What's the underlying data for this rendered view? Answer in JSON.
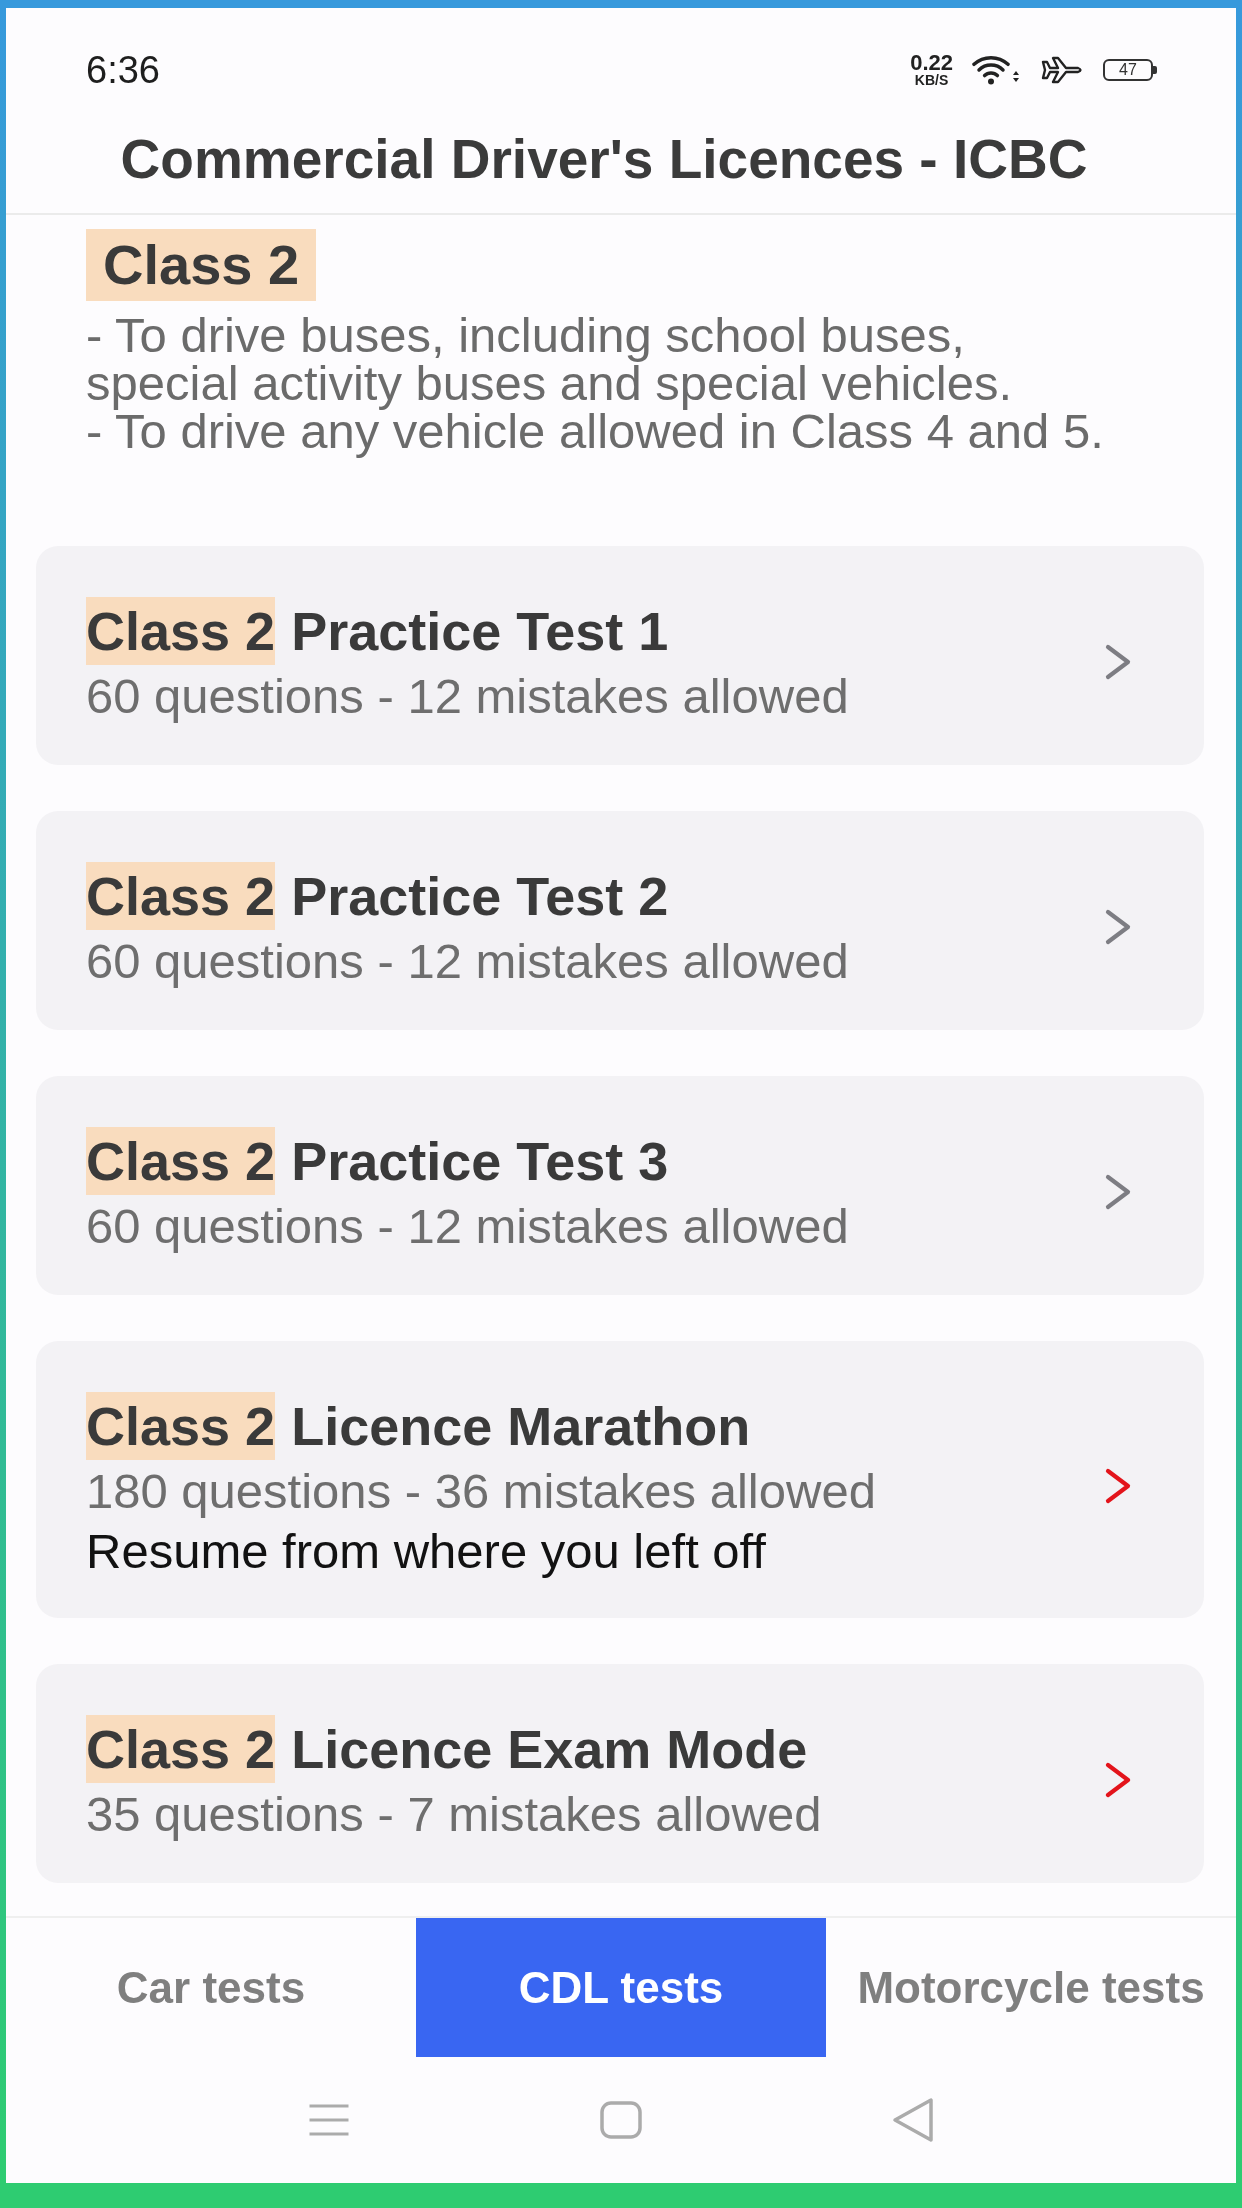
{
  "status_bar": {
    "time": "6:36",
    "net_speed": "0.22",
    "net_unit": "KB/S",
    "battery": "47"
  },
  "header": {
    "title": "Commercial Driver's Licences - ICBC"
  },
  "intro": {
    "heading": "Class 2",
    "bullets": [
      "- To drive buses, including school buses, special activity buses and special vehicles.",
      "- To drive any vehicle allowed in Class 4 and 5."
    ]
  },
  "tests": [
    {
      "tag": "Class 2",
      "title": "Practice Test 1",
      "info": "60 questions - 12 mistakes allowed",
      "color": "#7d7d83"
    },
    {
      "tag": "Class 2",
      "title": "Practice Test 2",
      "info": "60 questions - 12 mistakes allowed",
      "color": "#7d7d83"
    },
    {
      "tag": "Class 2",
      "title": "Practice Test 3",
      "info": "60 questions - 12 mistakes allowed",
      "color": "#7d7d83"
    },
    {
      "tag": "Class 2",
      "title": "Licence Marathon",
      "info": "180 questions - 36 mistakes allowed",
      "note": "Resume from where you left off",
      "color": "#e3141b"
    },
    {
      "tag": "Class 2",
      "title": "Licence Exam Mode",
      "info": "35 questions - 7 mistakes allowed",
      "color": "#e3141b"
    }
  ],
  "tabs": [
    {
      "label": "Car tests",
      "selected": false
    },
    {
      "label": "CDL tests",
      "selected": true
    },
    {
      "label": "Motorcycle tests",
      "selected": false
    }
  ]
}
